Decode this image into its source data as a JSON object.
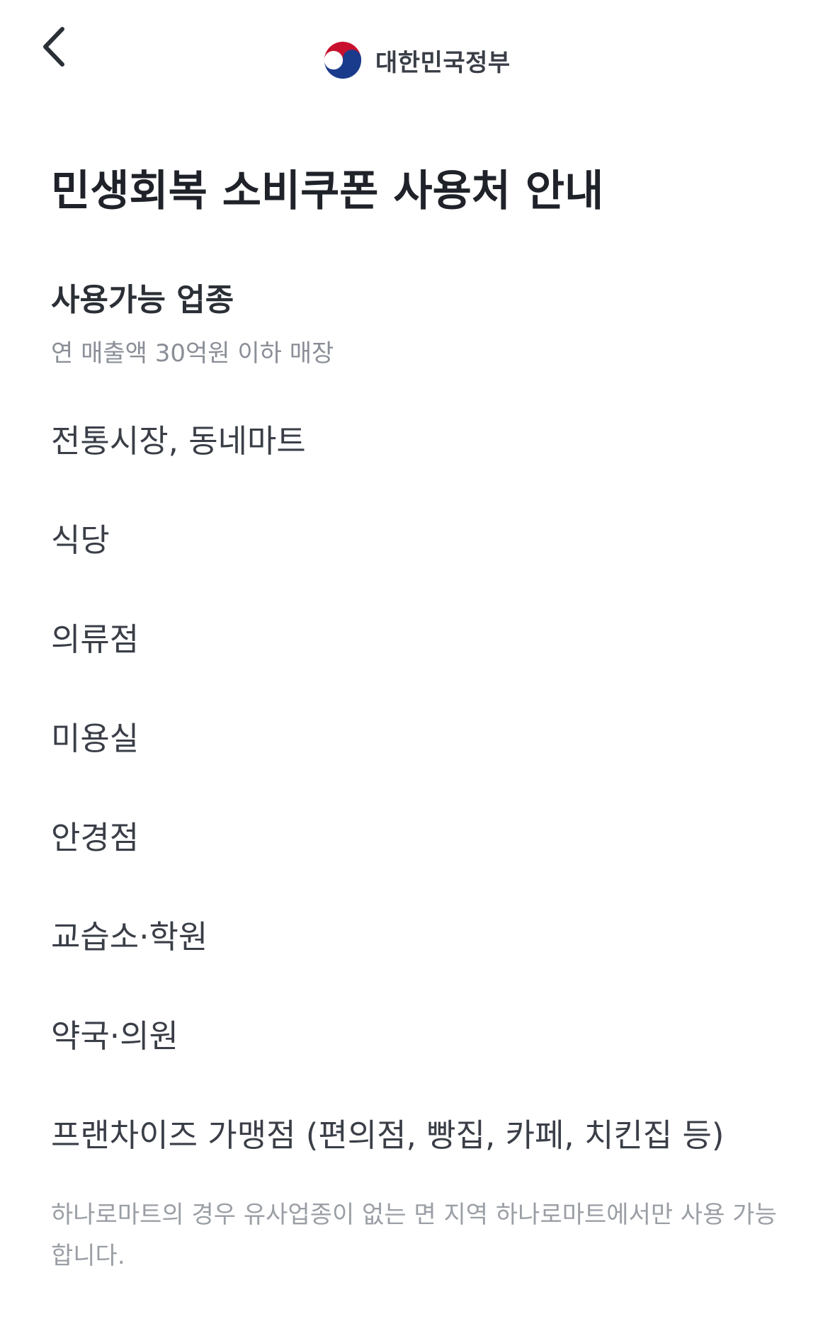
{
  "header": {
    "back_icon": "chevron-left-icon",
    "brand_name": "대한민국정부",
    "emblem_icon": "taegeuk-emblem-icon",
    "colors": {
      "emblem_red": "#c8102e",
      "emblem_blue": "#1a3b8b"
    }
  },
  "page": {
    "title": "민생회복 소비쿠폰 사용처 안내"
  },
  "section": {
    "title": "사용가능 업종",
    "subtitle": "연 매출액 30억원 이하 매장",
    "items": [
      "전통시장, 동네마트",
      "식당",
      "의류점",
      "미용실",
      "안경점",
      "교습소·학원",
      "약국·의원",
      "프랜차이즈 가맹점 (편의점, 빵집, 카페, 치킨집 등)"
    ],
    "note": "하나로마트의 경우 유사업종이 없는 면 지역 하나로마트에서만 사용 가능합니다."
  }
}
